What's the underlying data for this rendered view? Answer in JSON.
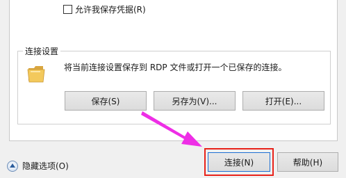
{
  "options": {
    "save_credentials_label": "允许我保存凭据(R)",
    "save_credentials_checked": false
  },
  "connection_settings": {
    "title": "连接设置",
    "description": "将当前连接设置保存到 RDP 文件或打开一个已保存的连接。",
    "save_label": "保存(S)",
    "save_as_label": "另存为(V)...",
    "open_label": "打开(E)..."
  },
  "footer": {
    "hide_options_label": "隐藏选项(O)",
    "connect_label": "连接(N)",
    "help_label": "帮助(H)"
  },
  "colors": {
    "annotation_arrow": "#ee2ee6",
    "highlight_box": "#e8221a",
    "focus_border": "#1b6fd3"
  },
  "icons": {
    "folder": "folder-icon",
    "toggle": "chevron-up-circle-icon"
  }
}
